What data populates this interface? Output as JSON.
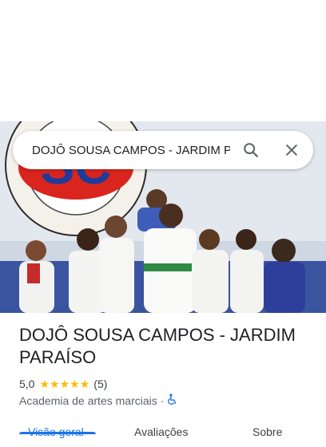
{
  "search": {
    "value": "DOJÔ SOUSA CAMPOS - JARDIM PARAÍSO",
    "search_icon": "search-icon",
    "close_icon": "close-icon"
  },
  "photo": {
    "logo_text": "SC"
  },
  "place": {
    "name": "DOJÔ SOUSA CAMPOS - JARDIM PARAÍSO",
    "rating": "5,0",
    "stars": 5,
    "review_count": "(5)",
    "category": "Academia de artes marciais",
    "separator": "·",
    "accessibility_icon": "wheelchair-icon"
  },
  "tabs": [
    {
      "label": "Visão geral",
      "active": true
    },
    {
      "label": "Avaliações",
      "active": false
    },
    {
      "label": "Sobre",
      "active": false
    }
  ],
  "colors": {
    "accent": "#1a73e8",
    "star": "#fbbc04",
    "text_primary": "#202124",
    "text_secondary": "#5f6368"
  }
}
